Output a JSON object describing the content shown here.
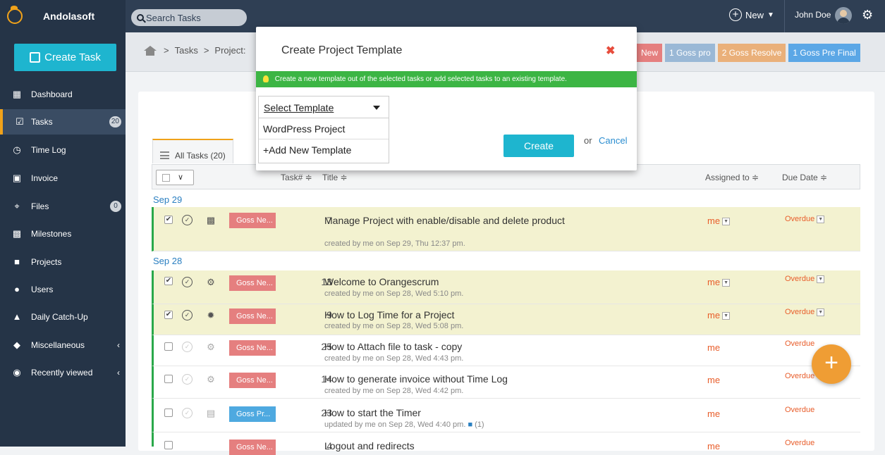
{
  "brand": {
    "name": "Andolasoft"
  },
  "search": {
    "placeholder": "Search Tasks"
  },
  "header": {
    "new_label": "New",
    "user_name": "John Doe"
  },
  "sidebar": {
    "create_label": "Create Task",
    "items": [
      {
        "label": "Dashboard"
      },
      {
        "label": "Tasks",
        "badge": "20"
      },
      {
        "label": "Time Log"
      },
      {
        "label": "Invoice"
      },
      {
        "label": "Files",
        "badge": "0"
      },
      {
        "label": "Milestones"
      },
      {
        "label": "Projects"
      },
      {
        "label": "Users"
      },
      {
        "label": "Daily Catch-Up"
      },
      {
        "label": "Miscellaneous"
      },
      {
        "label": "Recently viewed"
      }
    ]
  },
  "breadcrumb": {
    "tasks": "Tasks",
    "project": "Project:"
  },
  "status_chips": [
    {
      "label": "New",
      "color": "#e57f7f"
    },
    {
      "label": "1 Goss pro",
      "color": "#9ab8d6"
    },
    {
      "label": "2 Goss Resolve",
      "color": "#eab07a"
    },
    {
      "label": "1 Goss Pre Final",
      "color": "#5ba7e6"
    }
  ],
  "tab": {
    "label": "All Tasks (20)"
  },
  "table": {
    "headers": {
      "task_no": "Task# ≑",
      "title": "Title ≑",
      "assigned": "Assigned to ≑",
      "due": "Due Date ≑"
    }
  },
  "groups": [
    {
      "date": "Sep 29"
    },
    {
      "date": "Sep 28"
    }
  ],
  "rows": [
    {
      "num": "7",
      "title": "Manage Project with enable/disable and delete product",
      "sub": "created by me on Sep 29, Thu 12:37 pm.",
      "assigned": "me",
      "due": "Overdue",
      "tag": "Goss Ne...",
      "checked": "✔"
    },
    {
      "num": "13",
      "title": "Welcome to Orangescrum",
      "sub": "created by me on Sep 28, Wed 5:10 pm.",
      "assigned": "me",
      "due": "Overdue",
      "tag": "Goss Ne...",
      "checked": "✔"
    },
    {
      "num": "9",
      "title": "How to Log Time for a Project",
      "sub": "created by me on Sep 28, Wed 5:08 pm.",
      "assigned": "me",
      "due": "Overdue",
      "tag": "Goss Ne...",
      "checked": "✔"
    },
    {
      "num": "25",
      "title": "How to Attach file to task - copy",
      "sub": "created by me on Sep 28, Wed 4:43 pm.",
      "assigned": "me",
      "due": "Overdue",
      "tag": "Goss Ne..."
    },
    {
      "num": "14",
      "title": "How to generate invoice without Time Log",
      "sub": "created by me on Sep 28, Wed 4:42 pm.",
      "assigned": "me",
      "due": "Overdue",
      "tag": "Goss Ne..."
    },
    {
      "num": "23",
      "title": "How to start the Timer",
      "sub": "updated by me on Sep 28, Wed 4:40 pm.",
      "comments": "(1)",
      "assigned": "me",
      "due": "Overdue",
      "tag": "Goss Pr..."
    },
    {
      "num": "4",
      "title": "Logout and redirects",
      "assigned": "me",
      "due": "Overdue",
      "tag": "Goss Ne..."
    }
  ],
  "modal": {
    "title": "Create Project Template",
    "info": "Create a new template out of the selected tasks or add selected tasks to an existing template.",
    "select_label": "Select Template",
    "options": [
      "WordPress Project",
      "+Add New Template"
    ],
    "create_label": "Create",
    "or_label": "or",
    "cancel_label": "Cancel"
  }
}
